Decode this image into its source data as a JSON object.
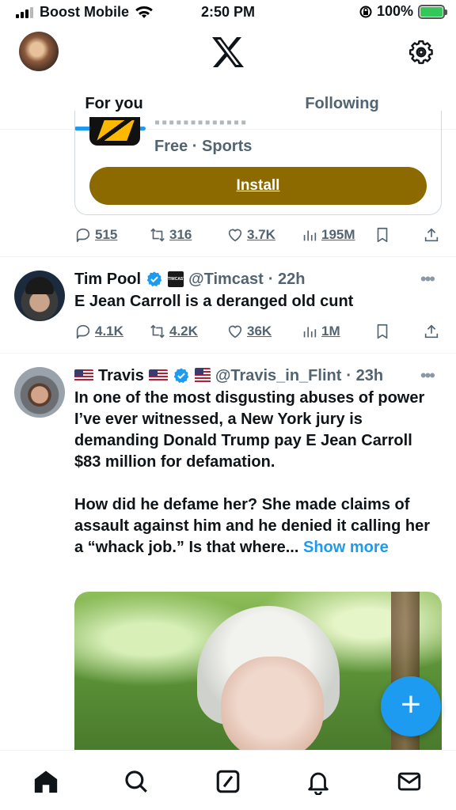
{
  "status_bar": {
    "carrier": "Boost Mobile",
    "time": "2:50 PM",
    "battery": "100%"
  },
  "header": {
    "tabs": [
      {
        "label": "For you",
        "active": true
      },
      {
        "label": "Following",
        "active": false
      }
    ]
  },
  "ad": {
    "partial_text": "▪▪▪▪▪▪▪▪▪▪▪▪▪",
    "subtitle": "Free · Sports",
    "install_label": "Install",
    "stats": {
      "replies": "515",
      "reposts": "316",
      "likes": "3.7K",
      "views": "195M"
    }
  },
  "tweets": [
    {
      "name": "Tim Pool",
      "badge": "TIMCAST",
      "handle": "@Timcast",
      "time": "· 22h",
      "text": "E Jean Carroll is a deranged old cunt",
      "stats": {
        "replies": "4.1K",
        "reposts": "4.2K",
        "likes": "36K",
        "views": "1M"
      }
    },
    {
      "name": "Travis",
      "handle": "@Travis_in_Flint",
      "time": "· 23h",
      "text_p1": "In one of the most disgusting abuses of power I’ve ever witnessed, a New York jury is demanding Donald Trump pay E Jean Carroll $83 million for defamation.",
      "text_p2": "How did he defame her?  She made claims of assault against him and he denied it calling her a “whack job.”  Is that where...",
      "show_more": "Show more"
    }
  ],
  "fab_label": "+",
  "colors": {
    "accent": "#1d9bf0",
    "install": "#8c6a00",
    "muted": "#536471"
  },
  "icons": [
    "x-logo-icon",
    "gear-icon",
    "reply-icon",
    "repost-icon",
    "like-icon",
    "views-icon",
    "bookmark-icon",
    "share-icon",
    "verified-icon",
    "home-icon",
    "search-icon",
    "grok-icon",
    "bell-icon",
    "mail-icon"
  ]
}
